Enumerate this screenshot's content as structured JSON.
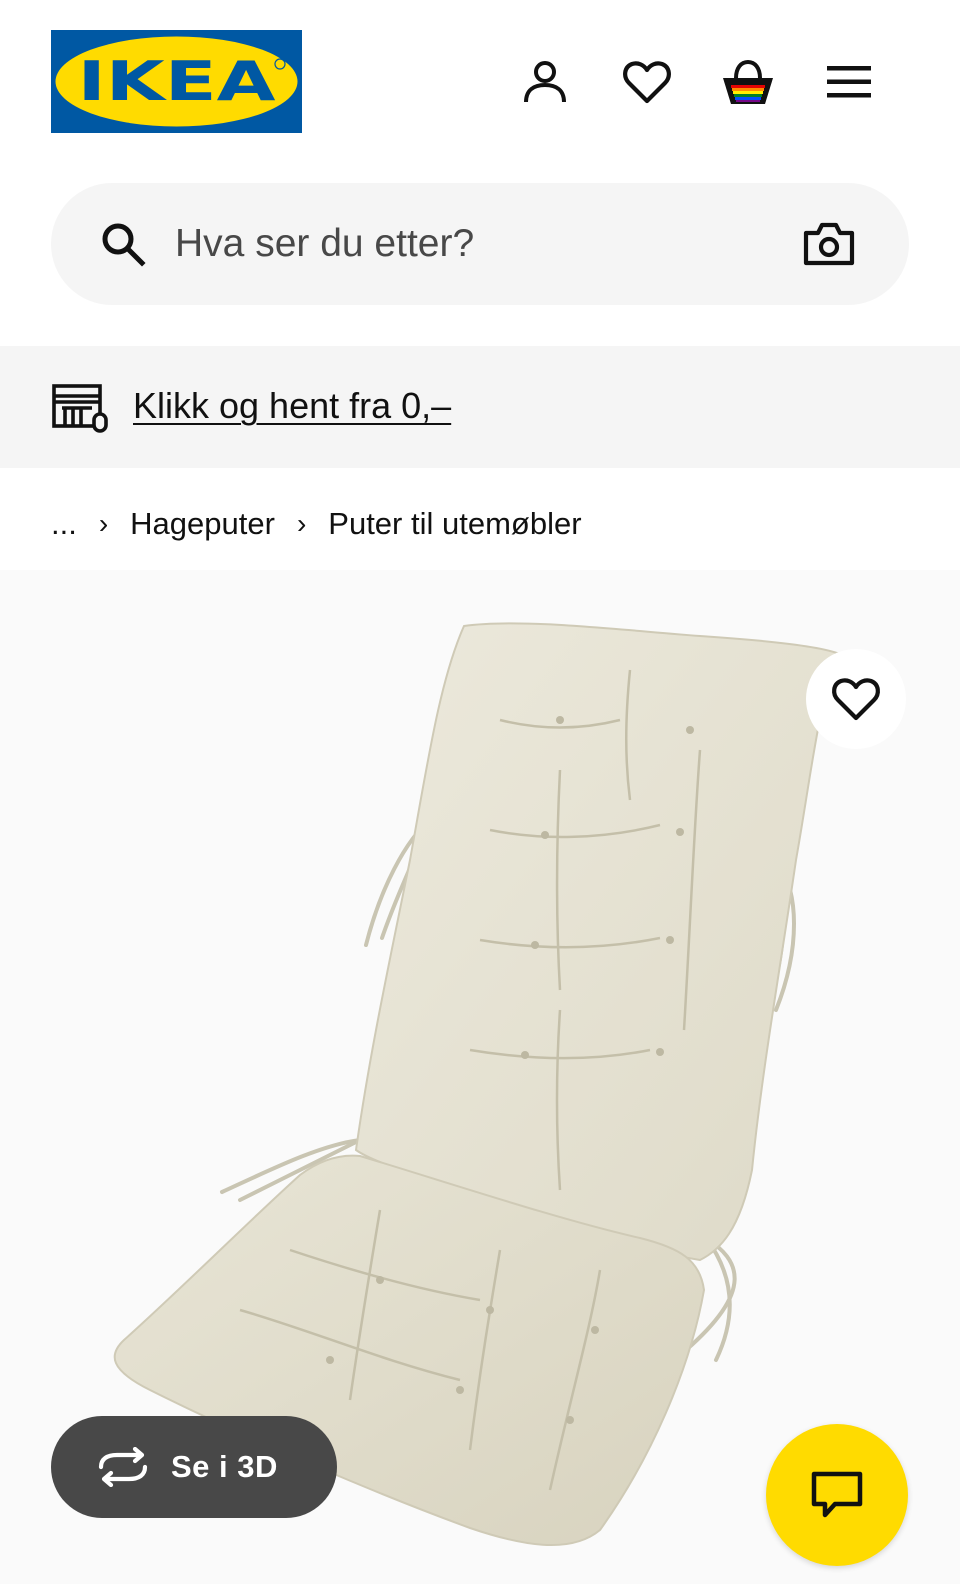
{
  "header": {
    "logo_text": "IKEA",
    "icons": [
      "account-icon",
      "wishlist-heart-icon",
      "shopping-bag-icon",
      "menu-hamburger-icon"
    ]
  },
  "search": {
    "placeholder": "Hva ser du etter?",
    "icons": [
      "search-icon",
      "camera-icon"
    ]
  },
  "banner": {
    "link_text": "Klikk og hent fra 0,–",
    "icon": "store-pickup-icon"
  },
  "breadcrumb": {
    "ellipsis": "...",
    "separator": "›",
    "items": [
      "Hageputer",
      "Puter til utemøbler"
    ]
  },
  "product": {
    "favorite_icon": "heart-icon",
    "view_3d_label": "Se i 3D",
    "view_3d_icon": "rotate-3d-icon"
  },
  "chat": {
    "icon": "chat-bubble-icon"
  },
  "colors": {
    "brand_blue": "#0058a3",
    "brand_yellow": "#ffdb00",
    "search_bg": "#f5f5f5",
    "banner_bg": "#f5f5f5",
    "btn_3d_bg": "#484848",
    "cushion": "#e6e2d2"
  }
}
